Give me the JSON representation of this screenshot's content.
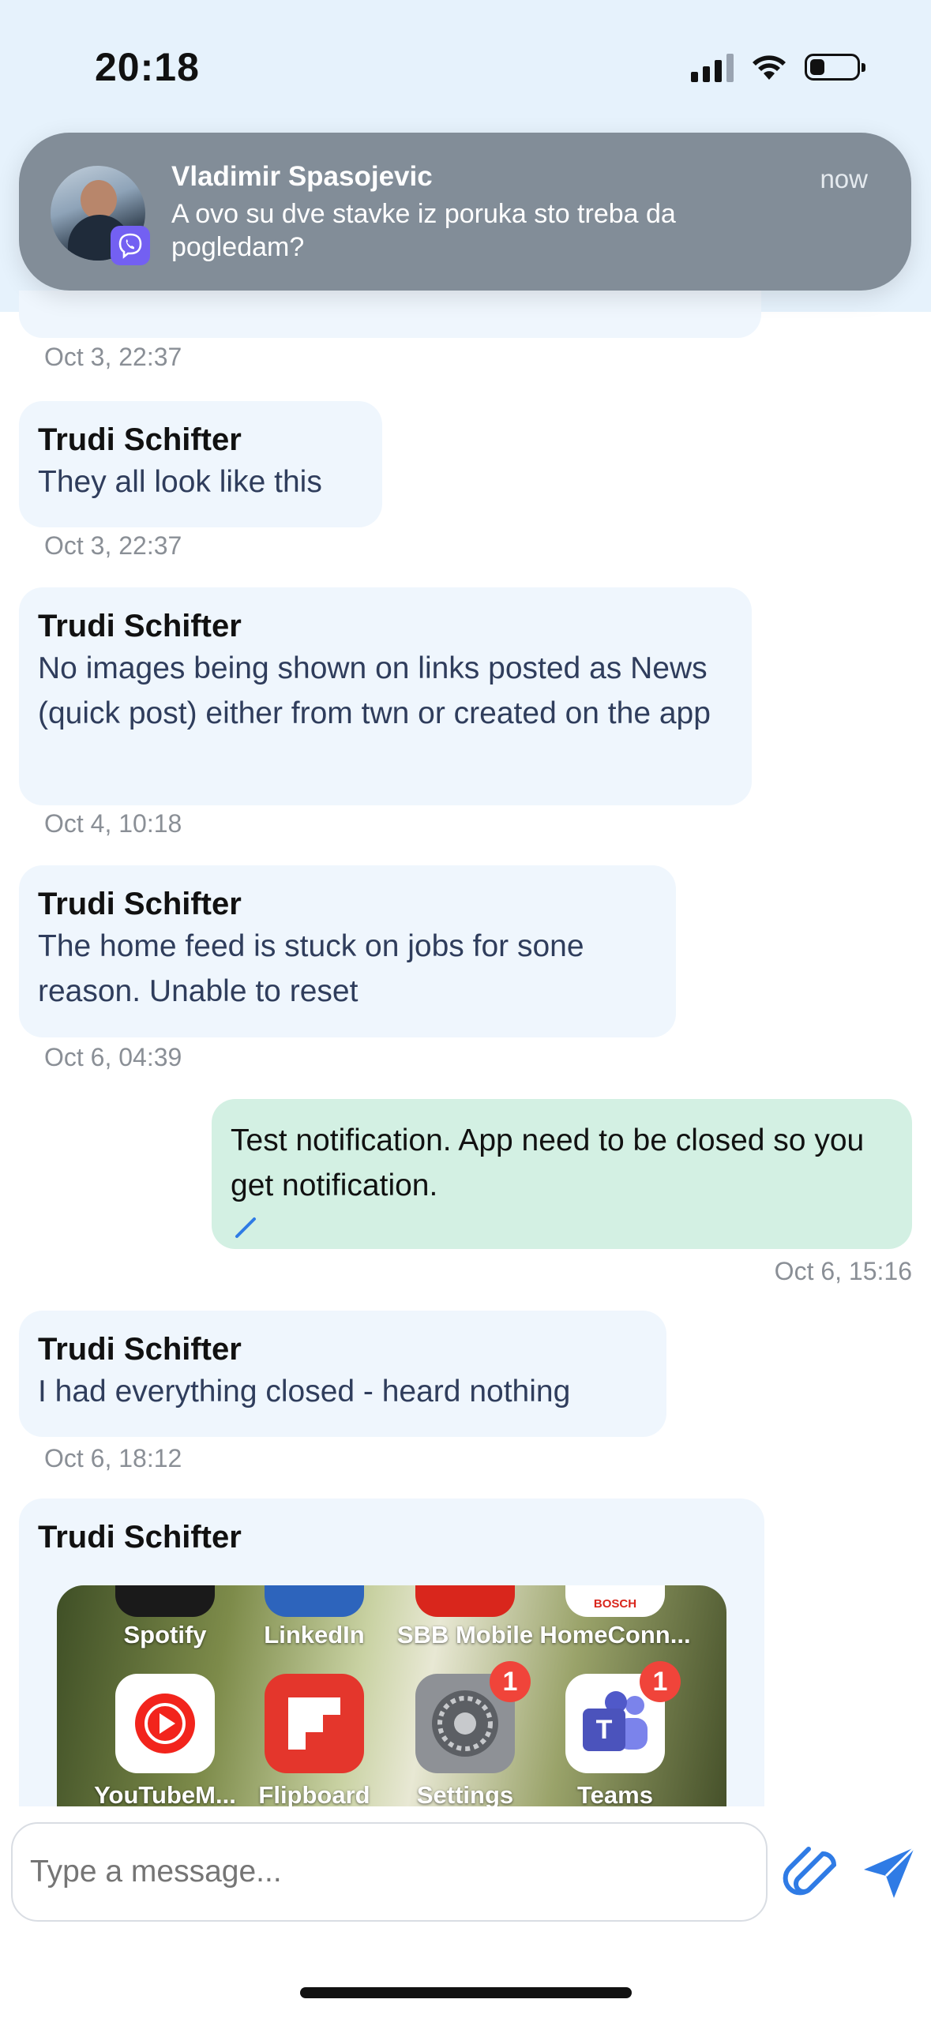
{
  "status_bar": {
    "time": "20:18"
  },
  "notification": {
    "sender": "Vladimir Spasojevic",
    "text": "A ovo su dve stavke iz poruka sto treba da pogledam?",
    "time": "now",
    "app_icon": "viber-icon"
  },
  "chat": {
    "messages": [
      {
        "sender": "",
        "text": "",
        "timestamp": "Oct 3, 22:37",
        "mine": false
      },
      {
        "sender": "Trudi Schifter",
        "text": "They all look like this",
        "timestamp": "Oct 3, 22:37",
        "mine": false
      },
      {
        "sender": "Trudi Schifter",
        "text": "No images being shown on links posted as News (quick post) either from twn or created on the app",
        "timestamp": "Oct 4, 10:18",
        "mine": false
      },
      {
        "sender": "Trudi Schifter",
        "text": "The home feed is stuck on jobs for sone reason.  Unable to reset",
        "timestamp": "Oct 6, 04:39",
        "mine": false
      },
      {
        "sender": "",
        "text": "Test notification. App need to be closed so you get notification.",
        "timestamp": "Oct 6, 15:16",
        "mine": true
      },
      {
        "sender": "Trudi Schifter",
        "text": "I had everything closed - heard nothing",
        "timestamp": "Oct 6, 18:12",
        "mine": false
      },
      {
        "sender": "Trudi Schifter",
        "text": "",
        "timestamp": "",
        "mine": false,
        "attachment": "image"
      }
    ],
    "attachment_apps": [
      {
        "label": "Spotify"
      },
      {
        "label": "LinkedIn"
      },
      {
        "label": "SBB Mobile"
      },
      {
        "label": "HomeConn..."
      },
      {
        "label": "YouTubeM...",
        "icon": "youtube-music-icon"
      },
      {
        "label": "Flipboard",
        "icon": "flipboard-icon"
      },
      {
        "label": "Settings",
        "icon": "settings-gear-icon",
        "badge": "1"
      },
      {
        "label": "Teams",
        "icon": "teams-icon",
        "badge": "1"
      }
    ],
    "attachment_brand": "BOSCH"
  },
  "composer": {
    "placeholder": "Type a message..."
  },
  "colors": {
    "incoming_bubble": "#eff6fd",
    "outgoing_bubble": "#d3f0e3",
    "accent": "#2f7be5"
  }
}
